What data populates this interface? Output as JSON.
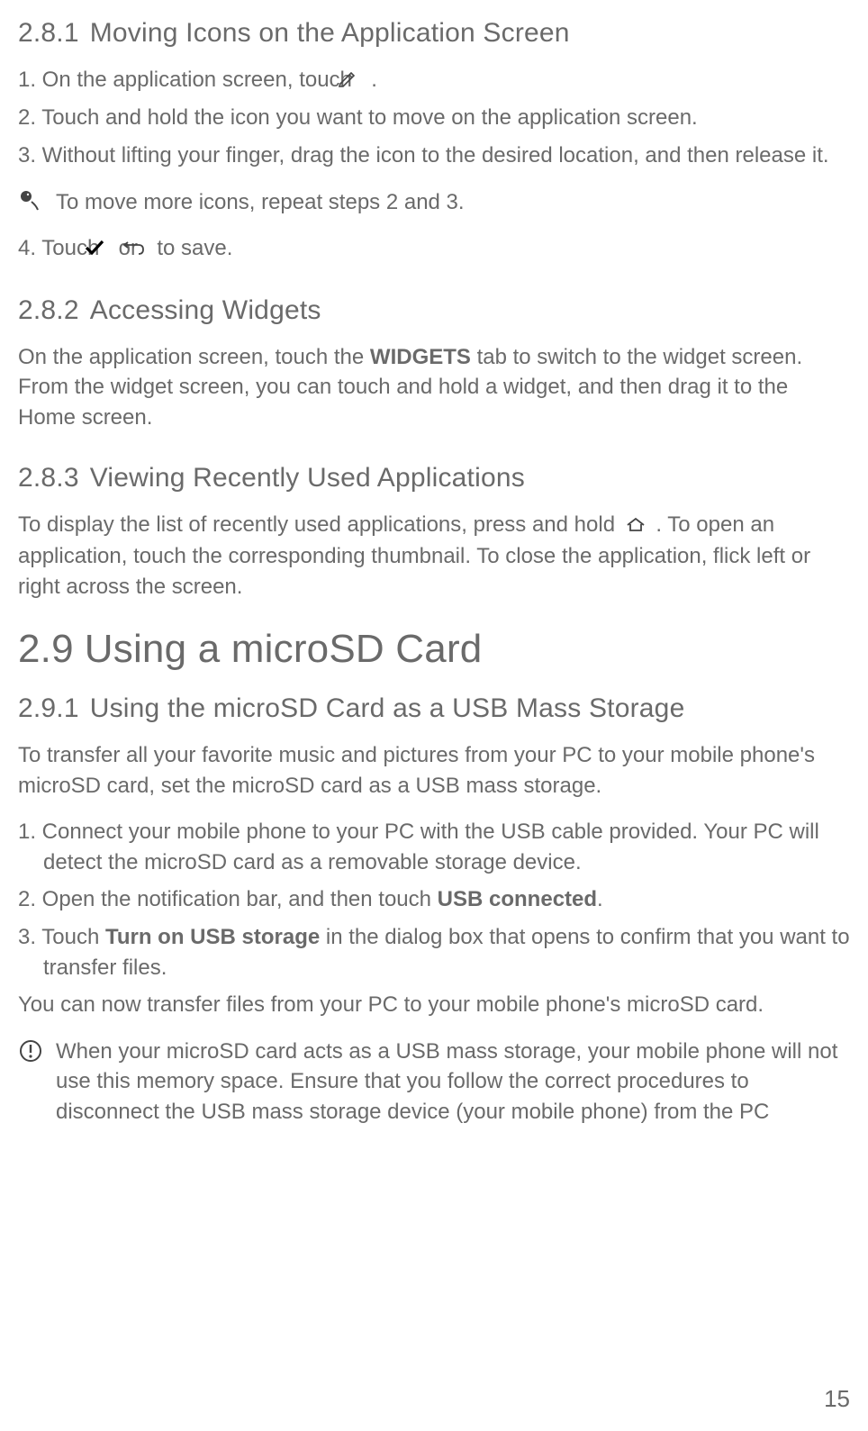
{
  "sections": {
    "s281": {
      "number": "2.8.1",
      "title": "Moving Icons on the Application Screen",
      "step1_a": "1. On the application screen, touch ",
      "step1_b": " .",
      "step2": "2. Touch and hold the icon you want to move on the application screen.",
      "step3": "3. Without lifting your finger, drag the icon to the desired location, and then release it.",
      "note": "To move more icons, repeat steps 2 and 3.",
      "step4_a": "4. Touch ",
      "step4_b": " or ",
      "step4_c": " to save."
    },
    "s282": {
      "number": "2.8.2",
      "title": "Accessing Widgets",
      "para_a": "On the application screen, touch the ",
      "para_bold": "WIDGETS",
      "para_b": " tab to switch to the widget screen. From the widget screen, you can touch and hold a widget, and then drag it to the Home screen."
    },
    "s283": {
      "number": "2.8.3",
      "title": "Viewing Recently Used Applications",
      "para_a": "To display the list of recently used applications, press and hold ",
      "para_b": " . To open an application, touch the corresponding thumbnail. To close the application, flick left or right across the screen."
    },
    "s29": {
      "number": "2.9",
      "title": "Using a microSD Card"
    },
    "s291": {
      "number": "2.9.1",
      "title": "Using the microSD Card as a USB Mass Storage",
      "intro": "To transfer all your favorite music and pictures from your PC to your mobile phone's microSD card, set the microSD card as a USB mass storage.",
      "step1": "1. Connect your mobile phone to your PC with the USB cable provided. Your PC will detect the microSD card as a removable storage device.",
      "step2_a": "2. Open the notification bar, and then touch ",
      "step2_bold": "USB connected",
      "step2_b": ".",
      "step3_a": "3. Touch ",
      "step3_bold": "Turn on USB storage",
      "step3_b": " in the dialog box that opens to confirm that you want to transfer files.",
      "after": "You can now transfer files from your PC to your mobile phone's microSD card.",
      "note": "When your microSD card acts as a USB mass storage, your mobile phone will not use this memory space. Ensure that you follow the correct procedures to disconnect the USB mass storage device (your mobile phone) from the PC"
    }
  },
  "page_number": "15"
}
